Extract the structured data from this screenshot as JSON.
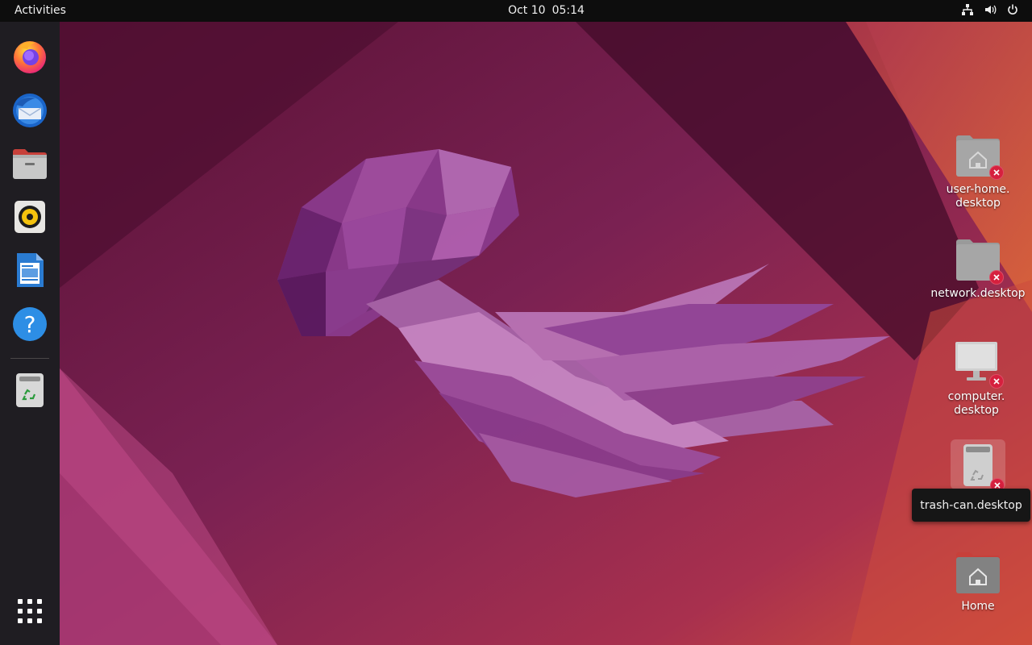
{
  "topbar": {
    "activities": "Activities",
    "date": "Oct 10",
    "time": "05:14",
    "tray_icons": [
      "network-icon",
      "volume-icon",
      "power-icon"
    ]
  },
  "dock": {
    "apps": [
      {
        "name": "Firefox",
        "icon": "firefox-icon"
      },
      {
        "name": "Thunderbird Mail",
        "icon": "thunderbird-icon"
      },
      {
        "name": "Files",
        "icon": "files-icon"
      },
      {
        "name": "Rhythmbox",
        "icon": "rhythmbox-icon"
      },
      {
        "name": "LibreOffice Writer",
        "icon": "writer-icon"
      },
      {
        "name": "Help",
        "icon": "help-icon"
      },
      {
        "name": "Trash",
        "icon": "trash-icon"
      }
    ],
    "show_apps_icon": "app-grid-icon"
  },
  "desktop": {
    "icons": [
      {
        "label": "user-home.\ndesktop",
        "icon": "home-folder-icon",
        "broken": true
      },
      {
        "label": "network.desktop",
        "icon": "network-folder-icon",
        "broken": true
      },
      {
        "label": "computer.\ndesktop",
        "icon": "computer-icon",
        "broken": true
      },
      {
        "label": "",
        "icon": "trash-icon",
        "broken": true,
        "selected": true
      },
      {
        "label": "Home",
        "icon": "home-folder-icon",
        "broken": false
      }
    ],
    "tooltip": "trash-can.desktop"
  },
  "colors": {
    "topbar": "#0d0d0d",
    "dock": "#1f1d22",
    "wallpaper_base": "#77214f",
    "error_badge": "#d6203e"
  }
}
